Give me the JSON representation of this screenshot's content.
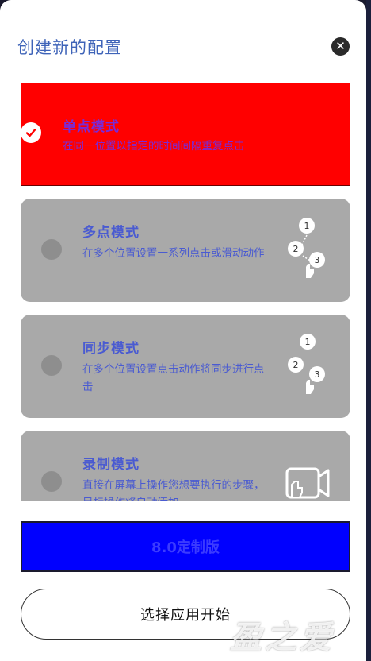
{
  "dialog": {
    "title": "创建新的配置",
    "close_icon": "close-icon"
  },
  "modes": [
    {
      "title": "单点模式",
      "description": "在同一位置以指定的时间间隔重复点击",
      "selected": true,
      "icon": "check-icon"
    },
    {
      "title": "多点模式",
      "description": "在多个位置设置一系列点击或滑动动作",
      "selected": false,
      "icon": "multi-tap-icon",
      "steps": [
        "1",
        "2",
        "3"
      ]
    },
    {
      "title": "同步模式",
      "description": "在多个位置设置点击动作将同步进行点击",
      "selected": false,
      "icon": "sync-tap-icon",
      "steps": [
        "1",
        "2",
        "3"
      ]
    },
    {
      "title": "录制模式",
      "description": "直接在屏幕上操作您想要执行的步骤，目标操作将自动添加",
      "selected": false,
      "icon": "record-icon"
    }
  ],
  "version_button": "8.0定制版",
  "start_button": "选择应用开始",
  "watermark": "盈之爱",
  "colors": {
    "selected_card": "#ff0000",
    "card": "#a9a9a9",
    "accent": "#4a5bd1",
    "version_button": "#0000ff"
  }
}
